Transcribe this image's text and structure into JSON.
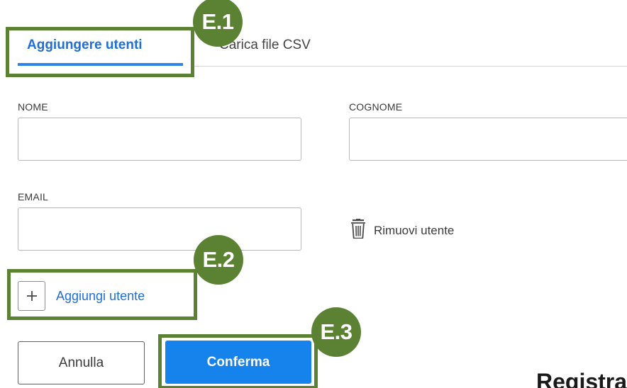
{
  "tabs": {
    "add_users": "Aggiungere utenti",
    "upload_csv": "Carica file CSV"
  },
  "form": {
    "first_name_label": "NOME",
    "first_name_value": "",
    "last_name_label": "COGNOME",
    "last_name_value": "",
    "email_label": "EMAIL",
    "email_value": "",
    "remove_user_label": "Rimuovi utente",
    "add_user_label": "Aggiungi utente"
  },
  "actions": {
    "cancel_label": "Annulla",
    "confirm_label": "Conferma"
  },
  "partial_heading": "Registra",
  "annotations": {
    "callout_1": "E.1",
    "callout_2": "E.2",
    "callout_3": "E.3"
  },
  "colors": {
    "accent_blue": "#1682ec",
    "tab_active_text": "#1f6fd6",
    "annotation_green": "#5a8232"
  },
  "icons": {
    "remove_user": "trash-icon",
    "add_user": "plus-icon"
  }
}
